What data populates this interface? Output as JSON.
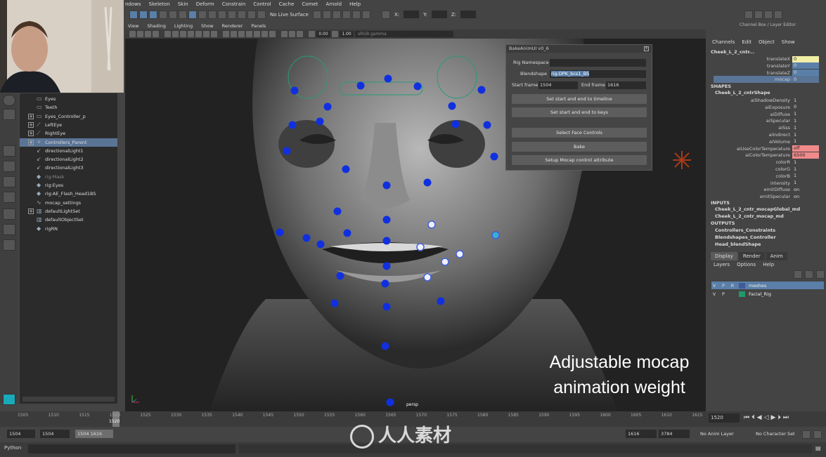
{
  "menubar": [
    "ndows",
    "Skeleton",
    "Skin",
    "Deform",
    "Constrain",
    "Control",
    "Cache",
    "Comet",
    "Arnold",
    "Help"
  ],
  "toolbar": {
    "live_surface": "No Live Surface",
    "x_label": "X:",
    "y_label": "Y:",
    "z_label": "Z:"
  },
  "outliner": [
    {
      "label": "Eyes",
      "expand": false,
      "icon": "mesh",
      "dim": false
    },
    {
      "label": "Teeth",
      "expand": false,
      "icon": "mesh",
      "dim": false
    },
    {
      "label": "Eyes_Controller_p",
      "expand": true,
      "icon": "mesh",
      "dim": false
    },
    {
      "label": "LeftEye",
      "expand": true,
      "icon": "joint",
      "dim": false
    },
    {
      "label": "RightEye",
      "expand": true,
      "icon": "joint",
      "dim": false
    },
    {
      "label": "Controllers_Parent",
      "expand": true,
      "icon": "star",
      "dim": false,
      "selected": true
    },
    {
      "label": "directionalLight1",
      "expand": false,
      "icon": "light",
      "dim": false
    },
    {
      "label": "directionalLight2",
      "expand": false,
      "icon": "light",
      "dim": false
    },
    {
      "label": "directionalLight3",
      "expand": false,
      "icon": "light",
      "dim": false
    },
    {
      "label": "rig:Mask",
      "expand": false,
      "icon": "ref",
      "dim": true
    },
    {
      "label": "rig:Eyes",
      "expand": false,
      "icon": "ref",
      "dim": false
    },
    {
      "label": "rig:AE_Flash_Head1BS",
      "expand": false,
      "icon": "ref",
      "dim": false
    },
    {
      "label": "mocap_settings",
      "expand": false,
      "icon": "curve",
      "dim": false
    },
    {
      "label": "defaultLightSet",
      "expand": true,
      "icon": "set",
      "dim": false
    },
    {
      "label": "defaultObjectSet",
      "expand": false,
      "icon": "set",
      "dim": false
    },
    {
      "label": "rigRN",
      "expand": false,
      "icon": "ref",
      "dim": false
    }
  ],
  "viewport": {
    "menu": [
      "View",
      "Shading",
      "Lighting",
      "Show",
      "Renderer",
      "Panels"
    ],
    "exposure": "0.00",
    "gamma_value": "1.00",
    "color_space": "sRGB gamma",
    "camera": "persp",
    "caption_line1": "Adjustable mocap",
    "caption_line2": "animation weight"
  },
  "dialog": {
    "title": "BakeAnimUI v0_6",
    "rig_namespace_label": "Rig Namespace",
    "rig_namespace_value": "",
    "blendshape_label": "Blendshape",
    "blendshape_value": "rig:DPK_bcs1_BS",
    "start_frame_label": "Start frame",
    "start_frame_value": "1504",
    "end_frame_label": "End frame",
    "end_frame_value": "1616",
    "btn_timeline": "Set start and end to timeline",
    "btn_keys": "Set start and end to keys",
    "btn_select": "Select Face Controls",
    "btn_bake": "Bake",
    "btn_setup": "Setup Mocap control attribute"
  },
  "channel_box": {
    "header": "Channel Box / Layer Editor",
    "menu": [
      "Channels",
      "Edit",
      "Object",
      "Show"
    ],
    "node": "Cheek_L_2_cntr...",
    "attrs": [
      {
        "name": "translateX",
        "value": "0",
        "style": "yl"
      },
      {
        "name": "translateY",
        "value": "0",
        "style": "bl"
      },
      {
        "name": "translateZ",
        "value": "0",
        "style": "bl"
      },
      {
        "name": "mocap",
        "value": "0",
        "style": "sel"
      }
    ],
    "shapes_label": "SHAPES",
    "shape_node": "Cheek_L_2_cntrShape",
    "shape_attrs": [
      {
        "name": "aiShadowDensity",
        "value": "1",
        "style": "nb"
      },
      {
        "name": "aiExposure",
        "value": "0",
        "style": "nb"
      },
      {
        "name": "aiDiffuse",
        "value": "1",
        "style": "nb"
      },
      {
        "name": "aiSpecular",
        "value": "1",
        "style": "nb"
      },
      {
        "name": "aiSss",
        "value": "1",
        "style": "nb"
      },
      {
        "name": "aiIndirect",
        "value": "1",
        "style": "nb"
      },
      {
        "name": "aiVolume",
        "value": "1",
        "style": "nb"
      },
      {
        "name": "aiUseColorTemperature",
        "value": "off",
        "style": "rd"
      },
      {
        "name": "aiColorTemperature",
        "value": "6500",
        "style": "rd"
      },
      {
        "name": "colorR",
        "value": "1",
        "style": "nb"
      },
      {
        "name": "colorG",
        "value": "1",
        "style": "nb"
      },
      {
        "name": "colorB",
        "value": "1",
        "style": "nb"
      },
      {
        "name": "intensity",
        "value": "1",
        "style": "nb"
      },
      {
        "name": "emitDiffuse",
        "value": "on",
        "style": "nb"
      },
      {
        "name": "emitSpecular",
        "value": "on",
        "style": "nb"
      }
    ],
    "inputs_label": "INPUTS",
    "inputs": [
      "Cheek_L_2_cntr_mocapGlobal_md",
      "Cheek_L_2_cntr_mocap_md"
    ],
    "outputs_label": "OUTPUTS",
    "outputs": [
      "Controllers_Constraints",
      "Blendshapes_Controller",
      "Head_blendShape"
    ]
  },
  "layer_editor": {
    "tabs": [
      "Display",
      "Render",
      "Anim"
    ],
    "menu": [
      "Layers",
      "Options",
      "Help"
    ],
    "layers": [
      {
        "v": "V",
        "p": "P",
        "r": "R",
        "name": "meshes",
        "color": "#3f5b9a",
        "selected": true
      },
      {
        "v": "V",
        "p": "P",
        "r": "",
        "name": "Facial_Rig",
        "color": "#1f9a6a",
        "selected": false
      }
    ]
  },
  "timeline": {
    "ticks": [
      "1505",
      "1510",
      "1515",
      "1520",
      "1525",
      "1530",
      "1535",
      "1540",
      "1545",
      "1550",
      "1555",
      "1560",
      "1565",
      "1570",
      "1575",
      "1580",
      "1585",
      "1590",
      "1595",
      "1600",
      "1605",
      "1610",
      "1615"
    ],
    "current": "1520",
    "current_frame_field": "1520"
  },
  "range": {
    "start": "1504",
    "start2": "1504",
    "slider_label": "1504 1616",
    "end": "1616",
    "end2": "3784",
    "anim_layer": "No Anim Layer",
    "char_set": "No Character Set"
  },
  "command": {
    "lang": "Python"
  },
  "watermark": "人人素材"
}
